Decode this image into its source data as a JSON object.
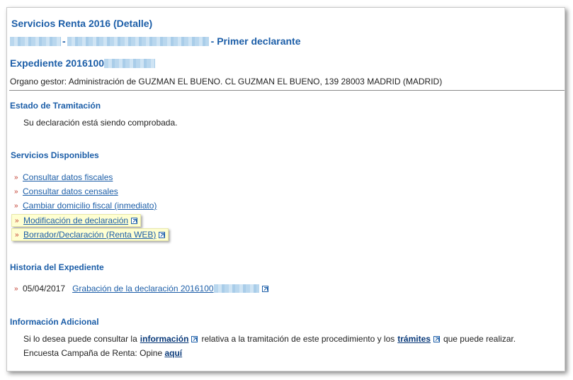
{
  "header": {
    "title": "Servicios Renta 2016 (Detalle)",
    "sep1": "-",
    "declarant_role": "- Primer declarante",
    "expediente_label": "Expediente 2016100",
    "organo": "Organo gestor: Administración de GUZMAN EL BUENO.  CL GUZMAN EL BUENO, 139 28003 MADRID (MADRID)"
  },
  "estado": {
    "heading": "Estado de Tramitación",
    "text": "Su declaración está siendo comprobada."
  },
  "servicios": {
    "heading": "Servicios Disponibles",
    "items": [
      {
        "label": "Consultar datos fiscales"
      },
      {
        "label": "Consultar datos censales"
      },
      {
        "label": "Cambiar domicilio fiscal (inmediato)"
      },
      {
        "label": "Modificación de declaración"
      },
      {
        "label": "Borrador/Declaración (Renta WEB)"
      }
    ]
  },
  "historia": {
    "heading": "Historia del Expediente",
    "date": "05/04/2017",
    "entry": "Grabación de la declaración 2016100"
  },
  "info": {
    "heading": "Información Adicional",
    "line1_a": "Si lo desea puede consultar la",
    "line1_link1": "información",
    "line1_b": "relativa a la tramitación de este procedimiento y los",
    "line1_link2": "trámites",
    "line1_c": "que puede realizar.",
    "line2_a": "Encuesta Campaña de Renta: Opine",
    "line2_link": "aquí"
  },
  "colors": {
    "accent": "#1c5ea8",
    "bullet": "#c0392b",
    "highlight": "#ffffd2"
  }
}
